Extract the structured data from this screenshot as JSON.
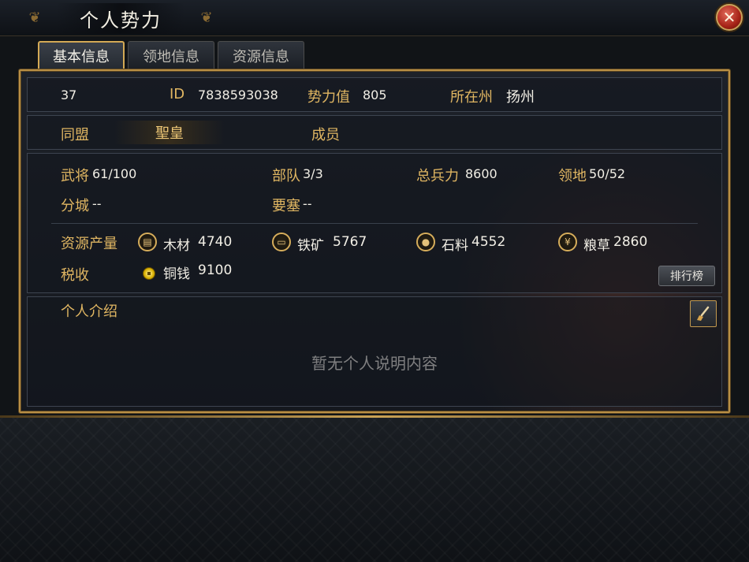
{
  "window": {
    "title": "个人势力",
    "close_icon": "close-icon"
  },
  "tabs": [
    {
      "label": "基本信息",
      "active": true
    },
    {
      "label": "领地信息",
      "active": false
    },
    {
      "label": "资源信息",
      "active": false
    }
  ],
  "summary": {
    "level": "37",
    "id_label": "ID",
    "id_value": "7838593038",
    "power_label": "势力值",
    "power_value": "805",
    "state_label": "所在州",
    "state_value": "扬州"
  },
  "alliance": {
    "label": "同盟",
    "name": "聖皇",
    "members_label": "成员"
  },
  "stats": {
    "generals_label": "武将",
    "generals_value": "61/100",
    "troops_label": "部队",
    "troops_value": "3/3",
    "total_force_label": "总兵力",
    "total_force_value": "8600",
    "territory_label": "领地",
    "territory_value": "50/52",
    "branch_city_label": "分城",
    "branch_city_value": "--",
    "fortress_label": "要塞",
    "fortress_value": "--"
  },
  "resources": {
    "label": "资源产量",
    "items": [
      {
        "name": "木材",
        "value": "4740",
        "icon": "wood-icon"
      },
      {
        "name": "铁矿",
        "value": "5767",
        "icon": "iron-icon"
      },
      {
        "name": "石料",
        "value": "4552",
        "icon": "stone-icon"
      },
      {
        "name": "粮草",
        "value": "2860",
        "icon": "grain-icon"
      }
    ],
    "tax_label": "税收",
    "tax_name": "铜钱",
    "tax_value": "9100",
    "tax_icon": "coin-icon"
  },
  "ranking_button": "排行榜",
  "profile": {
    "label": "个人介绍",
    "empty_text": "暂无个人说明内容",
    "edit_icon": "brush-icon"
  },
  "colors": {
    "accent_gold": "#e0b662",
    "frame_gold": "#b98f45",
    "close_red": "#a62317"
  }
}
